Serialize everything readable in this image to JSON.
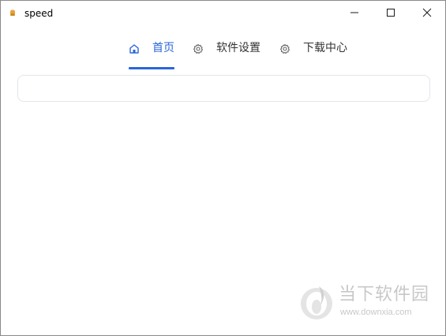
{
  "window": {
    "title": "speed",
    "controls": {
      "minimize_icon": "minimize-icon",
      "maximize_icon": "maximize-icon",
      "close_icon": "close-icon"
    }
  },
  "tabs": [
    {
      "label": "首页",
      "icon": "home-icon",
      "active": true
    },
    {
      "label": "软件设置",
      "icon": "gear-icon",
      "active": false
    },
    {
      "label": "下载中心",
      "icon": "gear-icon",
      "active": false
    }
  ],
  "colors": {
    "accent": "#2b66d9",
    "text": "#333333",
    "panel_border": "#e3e6ea",
    "watermark": "#c8c8c8"
  },
  "watermark": {
    "name": "当下软件园",
    "url": "www.downxia.com"
  }
}
